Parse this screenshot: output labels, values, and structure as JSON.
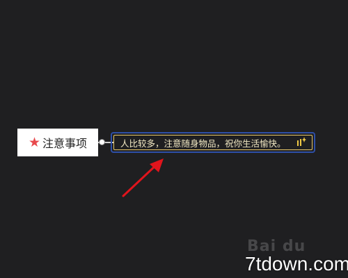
{
  "mindmap": {
    "root_topic": {
      "label": "注意事项",
      "icon": "star-icon",
      "icon_color": "#e8494d"
    },
    "sub_topic": {
      "text": "人比较多，注意随身物品，祝你生活愉快。",
      "selected": true,
      "icon": "sparkle-icon",
      "icon_glyph": "⫼✦"
    }
  },
  "annotation": {
    "arrow_color": "#e0141c"
  },
  "watermark": {
    "mark": "Bai du",
    "site": "7tdown.com"
  },
  "colors": {
    "background": "#1f1f21",
    "selection_border": "#2e4fa6",
    "topic_border": "#e9c96a",
    "topic_text": "#f2e9c4"
  }
}
